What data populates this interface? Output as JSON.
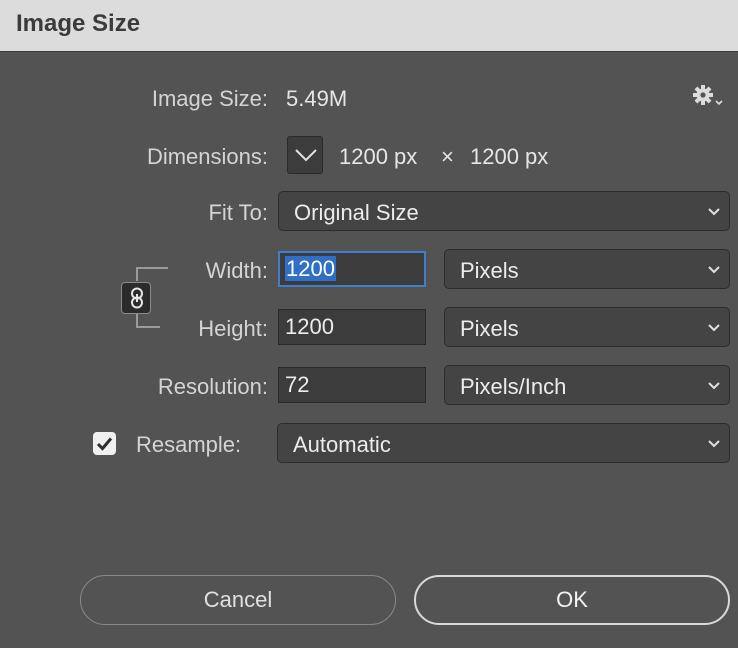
{
  "window": {
    "title": "Image Size"
  },
  "image_size": {
    "label": "Image Size:",
    "value": "5.49M"
  },
  "dimensions": {
    "label": "Dimensions:",
    "width": "1200 px",
    "separator": "×",
    "height": "1200 px"
  },
  "fit_to": {
    "label": "Fit To:",
    "value": "Original Size"
  },
  "width": {
    "label": "Width:",
    "value": "1200",
    "unit": "Pixels"
  },
  "height": {
    "label": "Height:",
    "value": "1200",
    "unit": "Pixels"
  },
  "resolution": {
    "label": "Resolution:",
    "value": "72",
    "unit": "Pixels/Inch"
  },
  "resample": {
    "label": "Resample:",
    "checked": true,
    "value": "Automatic"
  },
  "buttons": {
    "cancel": "Cancel",
    "ok": "OK"
  },
  "icons": {
    "settings": "gear-icon",
    "dimensions_toggle": "chevron-down-icon",
    "constrain": "link-icon",
    "check": "checkmark-icon",
    "dropdown": "chevron-down-icon"
  },
  "colors": {
    "dialog_bg": "#535353",
    "titlebar_bg": "#dcdcdc",
    "focus_border": "#3f7fd0",
    "selection": "#2f6fc6"
  }
}
